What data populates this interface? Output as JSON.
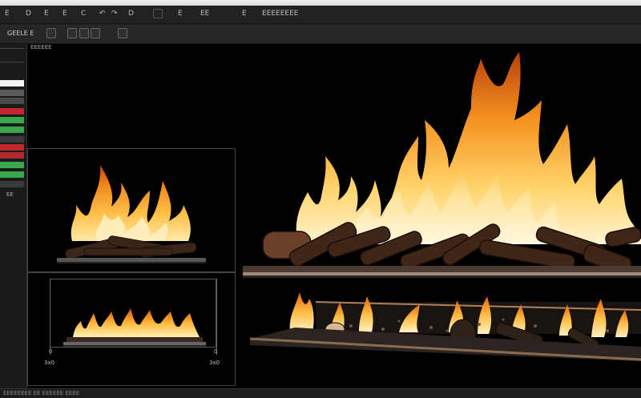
{
  "menubar": {
    "items": [
      "E",
      "D",
      "E",
      "E",
      "C",
      "D"
    ],
    "right_items": [
      "E",
      "EE",
      "E",
      "EEEEEEEE"
    ]
  },
  "toolbar": {
    "file_label": "GEELE E",
    "buttons": [
      "E",
      "E",
      "E",
      "E"
    ]
  },
  "sidebar": {
    "value_label": "EE"
  },
  "panel": {
    "title": "EEEEEE"
  },
  "preview_bottom": {
    "left_top": "0",
    "left_bottom": "3x0",
    "right_top": "0",
    "right_bottom": "3x0"
  },
  "status": {
    "text": "EEEEEEEE EE EEEEEE EEEE"
  },
  "colors": {
    "accent_red": "#c0282c",
    "accent_green": "#38a84a",
    "flame_yellow": "#ffd56b",
    "flame_orange": "#f08a1a"
  }
}
